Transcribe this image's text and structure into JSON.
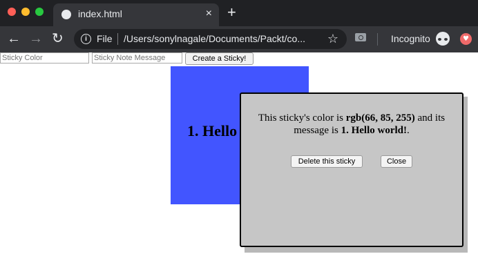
{
  "browser": {
    "tab_title": "index.html",
    "tab_close": "×",
    "new_tab": "+",
    "omnibox_scheme": "File",
    "omnibox_url": "/Users/sonylnagale/Documents/Packt/co...",
    "incognito_label": "Incognito",
    "icons": [
      "traffic-lights",
      "globe-icon",
      "back-arrow-icon",
      "forward-arrow-icon",
      "reload-icon",
      "info-icon",
      "star-icon",
      "camera-icon",
      "incognito-icon",
      "profile-icon"
    ]
  },
  "form": {
    "color_placeholder": "Sticky Color",
    "message_placeholder": "Sticky Note Message",
    "create_button": "Create a Sticky!"
  },
  "sticky": {
    "text": "1. Hello",
    "color": "#4255ff"
  },
  "dialog": {
    "msg_prefix": "This sticky's color is ",
    "color_value": "rgb(66, 85, 255)",
    "msg_middle": " and its message is ",
    "message_value": "1. Hello world!",
    "msg_suffix": ".",
    "delete_button": "Delete this sticky",
    "close_button": "Close"
  }
}
